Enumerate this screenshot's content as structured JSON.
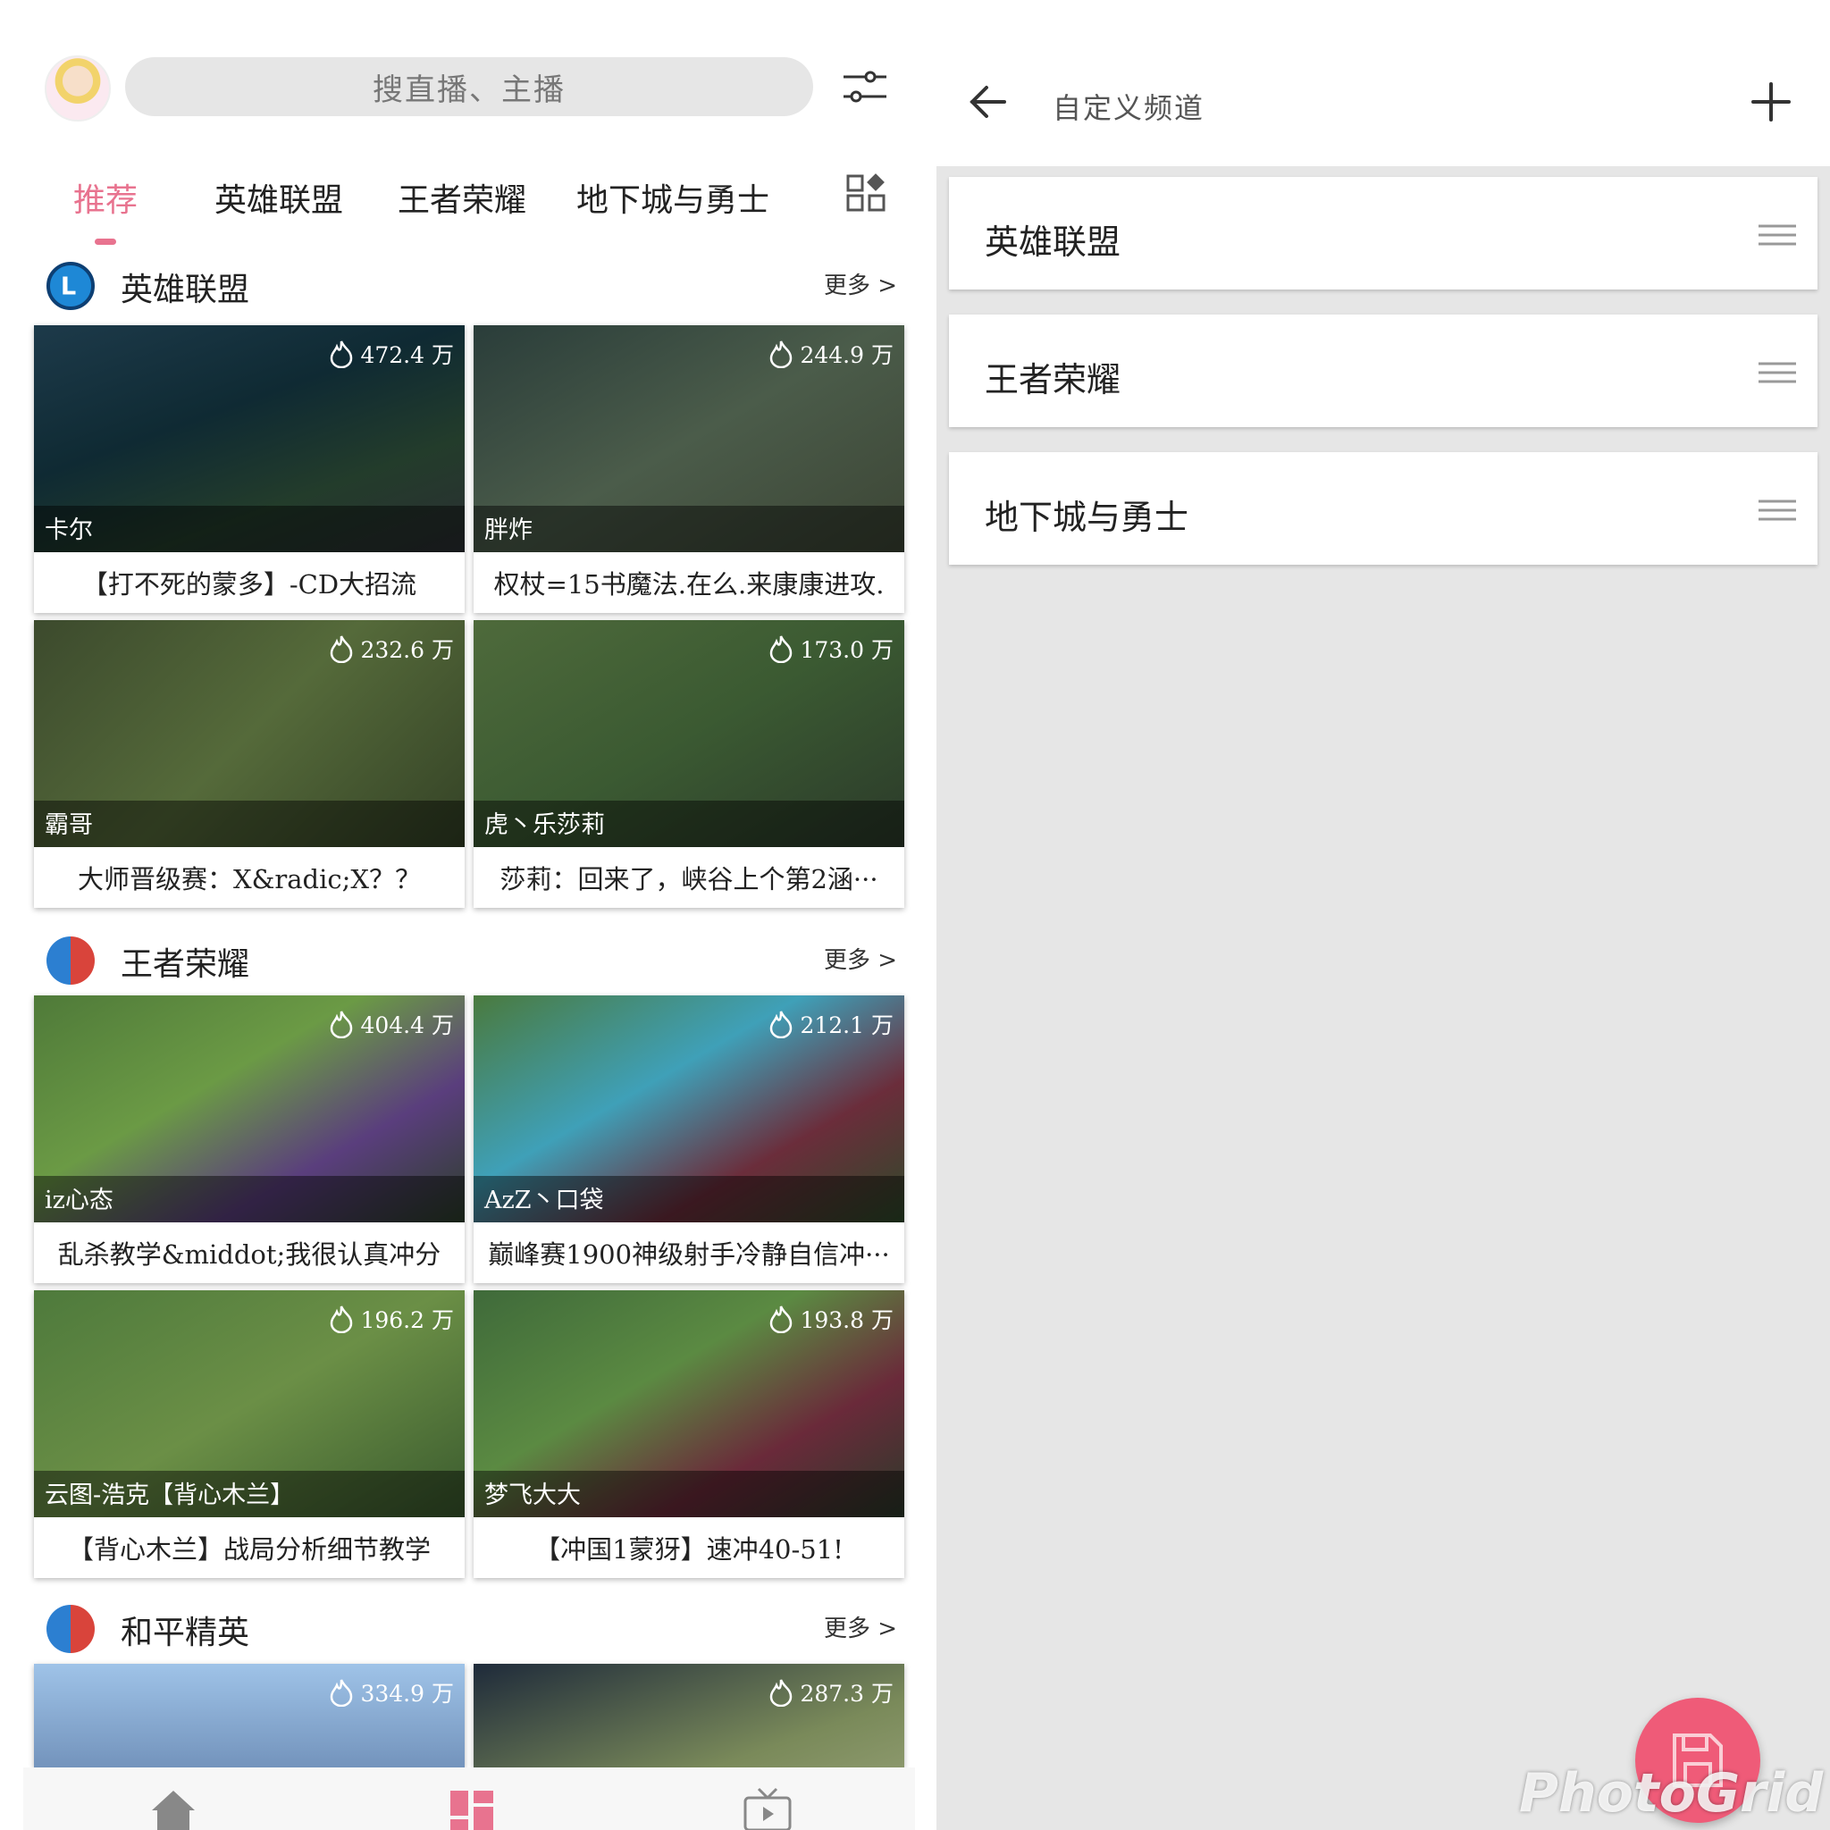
{
  "search": {
    "placeholder": "搜直播、主播"
  },
  "tabs": [
    {
      "label": "推荐",
      "active": true
    },
    {
      "label": "英雄联盟",
      "active": false
    },
    {
      "label": "王者荣耀",
      "active": false
    },
    {
      "label": "地下城与勇士",
      "active": false
    }
  ],
  "sections": [
    {
      "title": "英雄联盟",
      "more": "更多 >",
      "cards": [
        {
          "views": "472.4 万",
          "streamer": "卡尔",
          "title": "【打不死的蒙多】-CD大招流"
        },
        {
          "views": "244.9 万",
          "streamer": "胖炸",
          "title": "权杖=15书魔法.在么.来康康进攻."
        },
        {
          "views": "232.6 万",
          "streamer": "霸哥",
          "title": "大师晋级赛：X&radic;X？？"
        },
        {
          "views": "173.0 万",
          "streamer": "虎丶乐莎莉",
          "title": "莎莉：回来了，峡谷上个第2涵···"
        }
      ]
    },
    {
      "title": "王者荣耀",
      "more": "更多 >",
      "cards": [
        {
          "views": "404.4 万",
          "streamer": "iz心态",
          "title": "乱杀教学&middot;我很认真冲分"
        },
        {
          "views": "212.1 万",
          "streamer": "AzZ丶口袋",
          "title": "巅峰赛1900神级射手冷静自信冲···"
        },
        {
          "views": "196.2 万",
          "streamer": "云图-浩克【背心木兰】",
          "title": "【背心木兰】战局分析细节教学"
        },
        {
          "views": "193.8 万",
          "streamer": "梦飞大大",
          "title": "【冲国1蒙犽】速冲40-51!"
        }
      ]
    },
    {
      "title": "和平精英",
      "more": "更多 >",
      "cards": [
        {
          "views": "334.9 万",
          "streamer": "",
          "title": ""
        },
        {
          "views": "287.3 万",
          "streamer": "",
          "title": ""
        }
      ]
    }
  ],
  "custom_channel": {
    "title": "自定义频道",
    "channels": [
      "英雄联盟",
      "王者荣耀",
      "地下城与勇士"
    ]
  },
  "watermark": "PhotoGrid",
  "colors": {
    "accent": "#e8738f",
    "fab": "#ef5b78",
    "right_bg": "#e6e6e6"
  },
  "icons": [
    "filter-icon",
    "grid-edit-icon",
    "home-icon",
    "category-icon",
    "tv-icon",
    "back-arrow-icon",
    "plus-icon",
    "drag-handle-icon",
    "save-icon",
    "fire-icon"
  ]
}
